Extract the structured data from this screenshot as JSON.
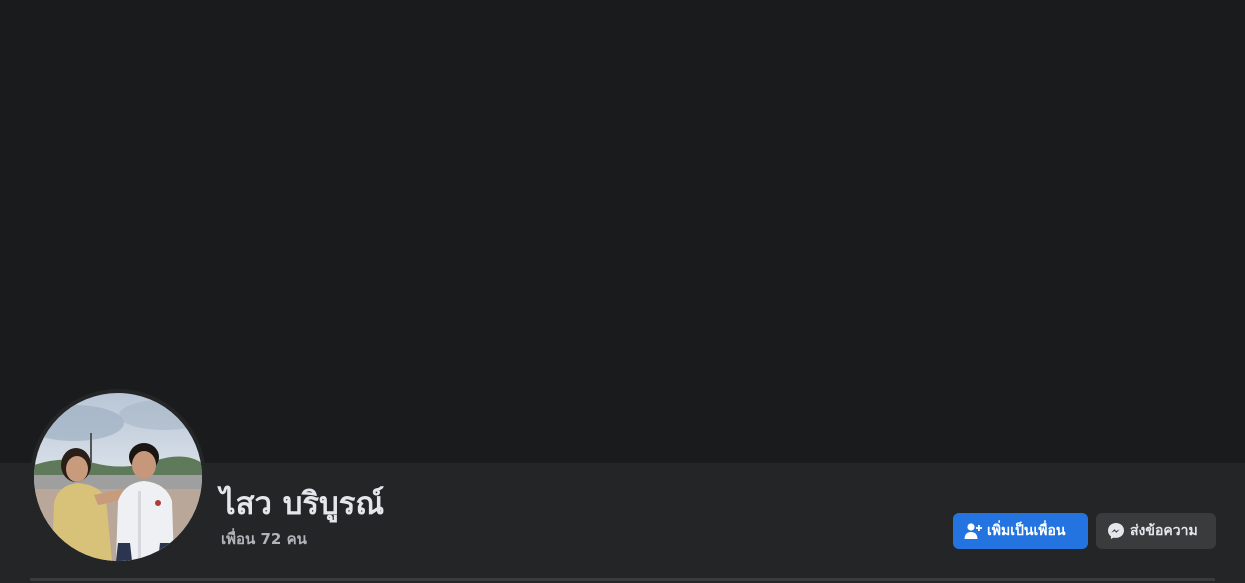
{
  "profile": {
    "name": "ไสว บริบูรณ์",
    "friends_count": "เพื่อน 72 คน",
    "avatar": "profile-photo-two-people"
  },
  "actions": {
    "add_friend_label": "เพิ่มเป็นเพื่อน",
    "add_friend_icon": "add-friend-icon",
    "message_label": "ส่งข้อความ",
    "message_icon": "messenger-icon"
  },
  "colors": {
    "background": "#18191a",
    "header": "#242526",
    "primary_button": "#2374e1",
    "secondary_button": "#3a3b3c",
    "name_text": "#e4e6eb",
    "secondary_text": "#b0b3b8"
  }
}
